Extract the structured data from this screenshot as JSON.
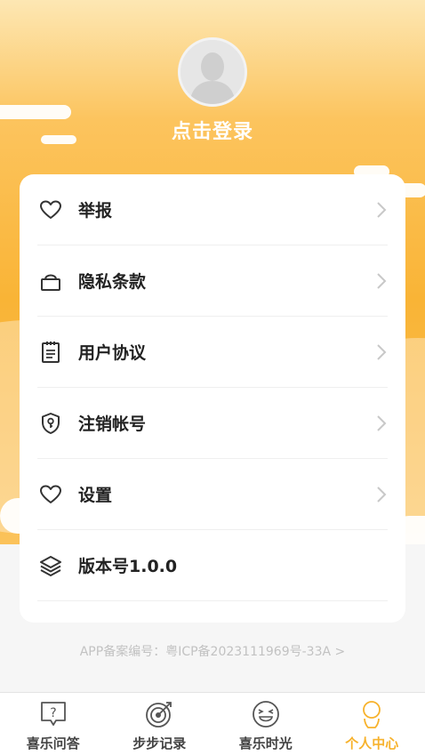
{
  "header": {
    "login_text": "点击登录",
    "avatar_icon": "default-user-avatar"
  },
  "menu": {
    "items": [
      {
        "label": "举报",
        "icon": "heart-icon"
      },
      {
        "label": "隐私条款",
        "icon": "lock-icon"
      },
      {
        "label": "用户协议",
        "icon": "clipboard-icon"
      },
      {
        "label": "注销帐号",
        "icon": "shield-key-icon"
      },
      {
        "label": "设置",
        "icon": "heart-icon"
      },
      {
        "label": "版本号1.0.0",
        "icon": "layers-icon"
      }
    ]
  },
  "footer": {
    "icp": "APP备案编号：粤ICP备2023111969号-33A >"
  },
  "tabbar": {
    "tabs": [
      {
        "label": "喜乐问答",
        "icon": "question-chat-icon"
      },
      {
        "label": "步步记录",
        "icon": "target-arrow-icon"
      },
      {
        "label": "喜乐时光",
        "icon": "laughing-face-icon"
      },
      {
        "label": "个人中心",
        "icon": "person-icon",
        "active": true
      }
    ]
  },
  "colors": {
    "accent": "#f7b22c",
    "hero_top": "#fde7b3",
    "hero_mid": "#f9b436"
  }
}
